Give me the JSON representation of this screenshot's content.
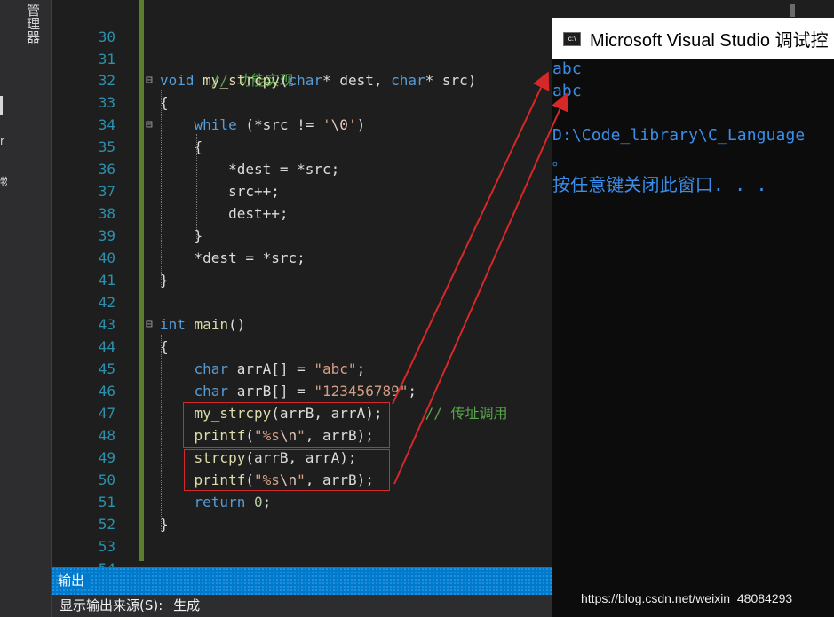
{
  "left_dock": {
    "tab_label": "管理器",
    "side_marks": [
      "",
      "r",
      "物"
    ]
  },
  "editor": {
    "lines": [
      {
        "num": "30",
        "fold": "",
        "segments": []
      },
      {
        "num": "31",
        "fold": "",
        "segments": []
      },
      {
        "num": "32",
        "fold": "",
        "segments": [
          {
            "t": "// 功能实现",
            "c": "cmt"
          }
        ]
      },
      {
        "num": "33",
        "fold": "⊟",
        "segments": [
          {
            "t": "void",
            "c": "kw"
          },
          {
            "t": " ",
            "c": ""
          },
          {
            "t": "my_strcpy",
            "c": "fn"
          },
          {
            "t": "(",
            "c": ""
          },
          {
            "t": "char",
            "c": "kw"
          },
          {
            "t": "* dest, ",
            "c": ""
          },
          {
            "t": "char",
            "c": "kw"
          },
          {
            "t": "* src)",
            "c": ""
          }
        ]
      },
      {
        "num": "34",
        "fold": "",
        "segments": [
          {
            "t": "{",
            "c": ""
          }
        ]
      },
      {
        "num": "35",
        "fold": "⊟",
        "segments": [
          {
            "t": "    ",
            "c": ""
          },
          {
            "t": "while",
            "c": "kw"
          },
          {
            "t": " (*src != ",
            "c": ""
          },
          {
            "t": "'",
            "c": "str"
          },
          {
            "t": "\\0",
            "c": "esc"
          },
          {
            "t": "'",
            "c": "str"
          },
          {
            "t": ")",
            "c": ""
          }
        ]
      },
      {
        "num": "36",
        "fold": "",
        "segments": [
          {
            "t": "    {",
            "c": ""
          }
        ]
      },
      {
        "num": "37",
        "fold": "",
        "segments": [
          {
            "t": "        *dest = *src;",
            "c": ""
          }
        ]
      },
      {
        "num": "38",
        "fold": "",
        "segments": [
          {
            "t": "        src++;",
            "c": ""
          }
        ]
      },
      {
        "num": "39",
        "fold": "",
        "segments": [
          {
            "t": "        dest++;",
            "c": ""
          }
        ]
      },
      {
        "num": "40",
        "fold": "",
        "segments": [
          {
            "t": "    }",
            "c": ""
          }
        ]
      },
      {
        "num": "41",
        "fold": "",
        "segments": [
          {
            "t": "    *dest = *src;",
            "c": ""
          }
        ]
      },
      {
        "num": "42",
        "fold": "",
        "segments": [
          {
            "t": "}",
            "c": ""
          }
        ]
      },
      {
        "num": "43",
        "fold": "",
        "segments": []
      },
      {
        "num": "44",
        "fold": "⊟",
        "segments": [
          {
            "t": "int",
            "c": "kw"
          },
          {
            "t": " ",
            "c": ""
          },
          {
            "t": "main",
            "c": "fn"
          },
          {
            "t": "()",
            "c": ""
          }
        ]
      },
      {
        "num": "45",
        "fold": "",
        "segments": [
          {
            "t": "{",
            "c": ""
          }
        ]
      },
      {
        "num": "46",
        "fold": "",
        "segments": [
          {
            "t": "    ",
            "c": ""
          },
          {
            "t": "char",
            "c": "kw"
          },
          {
            "t": " arrA[] = ",
            "c": ""
          },
          {
            "t": "\"abc\"",
            "c": "str"
          },
          {
            "t": ";",
            "c": ""
          }
        ]
      },
      {
        "num": "47",
        "fold": "",
        "segments": [
          {
            "t": "    ",
            "c": ""
          },
          {
            "t": "char",
            "c": "kw"
          },
          {
            "t": " arrB[] = ",
            "c": ""
          },
          {
            "t": "\"123456789\"",
            "c": "str"
          },
          {
            "t": ";",
            "c": ""
          }
        ]
      },
      {
        "num": "48",
        "fold": "",
        "segments": [
          {
            "t": "    ",
            "c": ""
          },
          {
            "t": "my_strcpy",
            "c": "fn"
          },
          {
            "t": "(arrB, arrA);",
            "c": ""
          },
          {
            "t": "     // 传址调用",
            "c": "cmt"
          }
        ]
      },
      {
        "num": "49",
        "fold": "",
        "segments": [
          {
            "t": "    ",
            "c": ""
          },
          {
            "t": "printf",
            "c": "fn"
          },
          {
            "t": "(",
            "c": ""
          },
          {
            "t": "\"%s",
            "c": "str"
          },
          {
            "t": "\\n",
            "c": "esc"
          },
          {
            "t": "\"",
            "c": "str"
          },
          {
            "t": ", arrB);",
            "c": ""
          }
        ]
      },
      {
        "num": "50",
        "fold": "",
        "segments": [
          {
            "t": "    ",
            "c": ""
          },
          {
            "t": "strcpy",
            "c": "fn"
          },
          {
            "t": "(arrB, arrA);",
            "c": ""
          }
        ]
      },
      {
        "num": "51",
        "fold": "",
        "segments": [
          {
            "t": "    ",
            "c": ""
          },
          {
            "t": "printf",
            "c": "fn"
          },
          {
            "t": "(",
            "c": ""
          },
          {
            "t": "\"%s",
            "c": "str"
          },
          {
            "t": "\\n",
            "c": "esc"
          },
          {
            "t": "\"",
            "c": "str"
          },
          {
            "t": ", arrB);",
            "c": ""
          }
        ]
      },
      {
        "num": "52",
        "fold": "",
        "segments": [
          {
            "t": "    ",
            "c": ""
          },
          {
            "t": "return",
            "c": "kw"
          },
          {
            "t": " ",
            "c": ""
          },
          {
            "t": "0",
            "c": "num"
          },
          {
            "t": ";",
            "c": ""
          }
        ]
      },
      {
        "num": "53",
        "fold": "",
        "segments": [
          {
            "t": "}",
            "c": ""
          }
        ]
      },
      {
        "num": "54",
        "fold": "",
        "segments": []
      }
    ]
  },
  "console": {
    "title": "Microsoft Visual Studio 调试控",
    "icon": "c:\\",
    "output_lines": [
      "abc",
      "abc",
      "",
      "D:\\Code_library\\C_Language",
      "。",
      "按任意键关闭此窗口. . ."
    ]
  },
  "output_panel": {
    "title": "输出",
    "source_label": "显示输出来源(S):",
    "source_value": "生成"
  },
  "watermark": "https://blog.csdn.net/weixin_48084293",
  "colors": {
    "editor_bg": "#1e1e1e",
    "line_number": "#2b91af",
    "keyword": "#569cd6",
    "function": "#dcdcaa",
    "string": "#d69d85",
    "comment": "#57a64a",
    "console_text": "#3b8eea",
    "output_header": "#007acc",
    "annotation_red": "#d62828"
  }
}
